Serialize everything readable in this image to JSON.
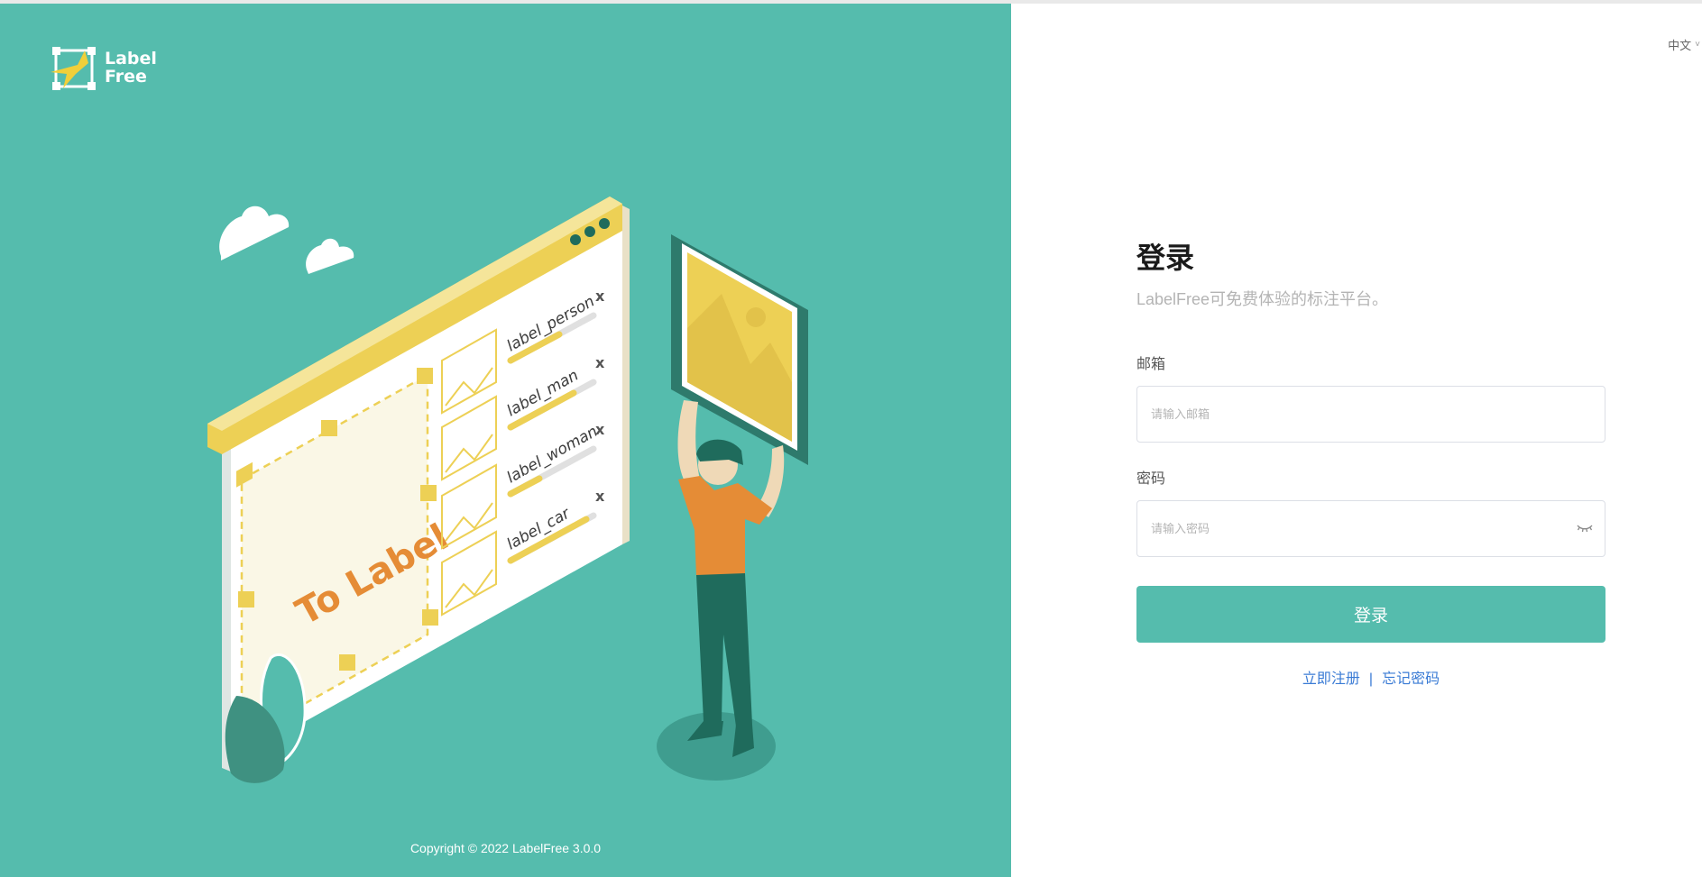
{
  "brand": {
    "logo_text_line1": "Label",
    "logo_text_line2": "Free"
  },
  "illustration": {
    "canvas_text": "To Label",
    "labels": [
      "label_person",
      "label_man",
      "label_woman",
      "label_car"
    ],
    "close_mark": "x"
  },
  "footer": {
    "copyright": "Copyright © 2022 LabelFree 3.0.0"
  },
  "lang": {
    "current": "中文",
    "chevron": "˅"
  },
  "login": {
    "title": "登录",
    "subtitle": "LabelFree可免费体验的标注平台。",
    "email_label": "邮箱",
    "email_placeholder": "请输入邮箱",
    "password_label": "密码",
    "password_placeholder": "请输入密码",
    "submit_label": "登录",
    "register_link": "立即注册",
    "separator": "|",
    "forgot_link": "忘记密码"
  },
  "colors": {
    "accent": "#55bcad",
    "link": "#3a7bd5",
    "yellow": "#edd055",
    "orange": "#e58c36",
    "dark_teal": "#1f6b5c"
  }
}
